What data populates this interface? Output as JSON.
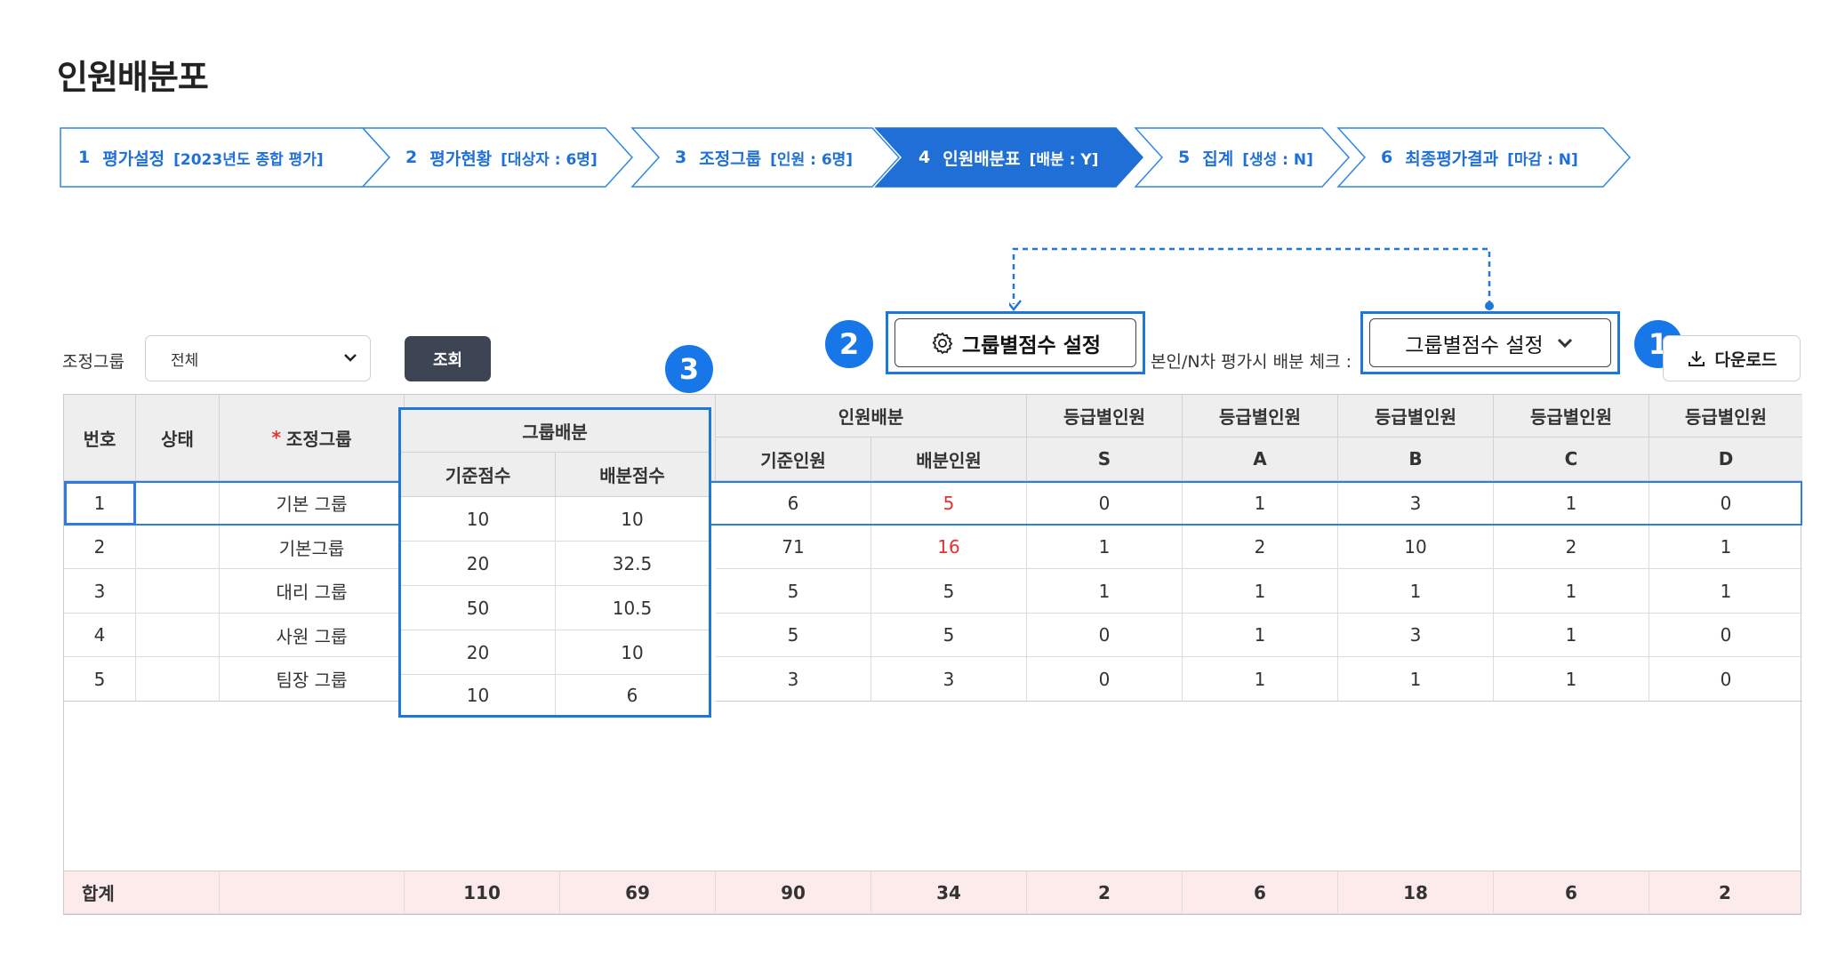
{
  "page": {
    "title": "인원배분포"
  },
  "stepper": [
    {
      "num": "1",
      "label": "평가설정",
      "sub": "[2023년도 종합 평가]",
      "active": false
    },
    {
      "num": "2",
      "label": "평가현황",
      "sub": "[대상자 : 6명]",
      "active": false
    },
    {
      "num": "3",
      "label": "조정그룹",
      "sub": "[인원 : 6명]",
      "active": false
    },
    {
      "num": "4",
      "label": "인원배분표",
      "sub": "[배분 : Y]",
      "active": true
    },
    {
      "num": "5",
      "label": "집계",
      "sub": "[생성 : N]",
      "active": false
    },
    {
      "num": "6",
      "label": "최종평가결과",
      "sub": "[마감 : N]",
      "active": false
    }
  ],
  "filter": {
    "label": "조정그룹",
    "selected": "전체",
    "search_label": "조회"
  },
  "toolbar": {
    "group_score_button": "그룹별점수 설정",
    "self_check_label": "본인/N차 평가시 배분 체크 :",
    "group_dropdown": "그룹별점수 설정",
    "download_label": "다운로드",
    "badge1": "1",
    "badge2": "2",
    "badge3": "3"
  },
  "table": {
    "headers": {
      "no": "번호",
      "status": "상태",
      "group_required": "*",
      "group": "조정그룹",
      "group_alloc": "그룹배분",
      "base_score": "기준점수",
      "alloc_score": "배분점수",
      "person_alloc": "인원배분",
      "base_person": "기준인원",
      "alloc_person": "배분인원",
      "grade_person": "등급별인원",
      "grades": [
        "S",
        "A",
        "B",
        "C",
        "D"
      ]
    },
    "rows": [
      {
        "no": "1",
        "status": "",
        "group": "기본 그룹",
        "base_score": "10",
        "alloc_score": "10",
        "base_person": "6",
        "alloc_person": "5",
        "alloc_red": true,
        "S": "0",
        "A": "1",
        "B": "3",
        "C": "1",
        "D": "0"
      },
      {
        "no": "2",
        "status": "",
        "group": "기본그룹",
        "base_score": "20",
        "alloc_score": "32.5",
        "base_person": "71",
        "alloc_person": "16",
        "alloc_red": true,
        "S": "1",
        "A": "2",
        "B": "10",
        "C": "2",
        "D": "1"
      },
      {
        "no": "3",
        "status": "",
        "group": "대리 그룹",
        "base_score": "50",
        "alloc_score": "10.5",
        "base_person": "5",
        "alloc_person": "5",
        "alloc_red": false,
        "S": "1",
        "A": "1",
        "B": "1",
        "C": "1",
        "D": "1"
      },
      {
        "no": "4",
        "status": "",
        "group": "사원 그룹",
        "base_score": "20",
        "alloc_score": "10",
        "base_person": "5",
        "alloc_person": "5",
        "alloc_red": false,
        "S": "0",
        "A": "1",
        "B": "3",
        "C": "1",
        "D": "0"
      },
      {
        "no": "5",
        "status": "",
        "group": "팀장 그룹",
        "base_score": "10",
        "alloc_score": "6",
        "base_person": "3",
        "alloc_person": "3",
        "alloc_red": false,
        "S": "0",
        "A": "1",
        "B": "1",
        "C": "1",
        "D": "0"
      }
    ],
    "total": {
      "label": "합계",
      "base_score": "110",
      "alloc_score": "69",
      "base_person": "90",
      "alloc_person": "34",
      "S": "2",
      "A": "6",
      "B": "18",
      "C": "6",
      "D": "2"
    }
  },
  "colors": {
    "accent": "#1877e8",
    "dark_button": "#3d4454",
    "red_value": "#e53030",
    "total_row_bg": "#fdeaea",
    "header_bg": "#eeeeee"
  }
}
